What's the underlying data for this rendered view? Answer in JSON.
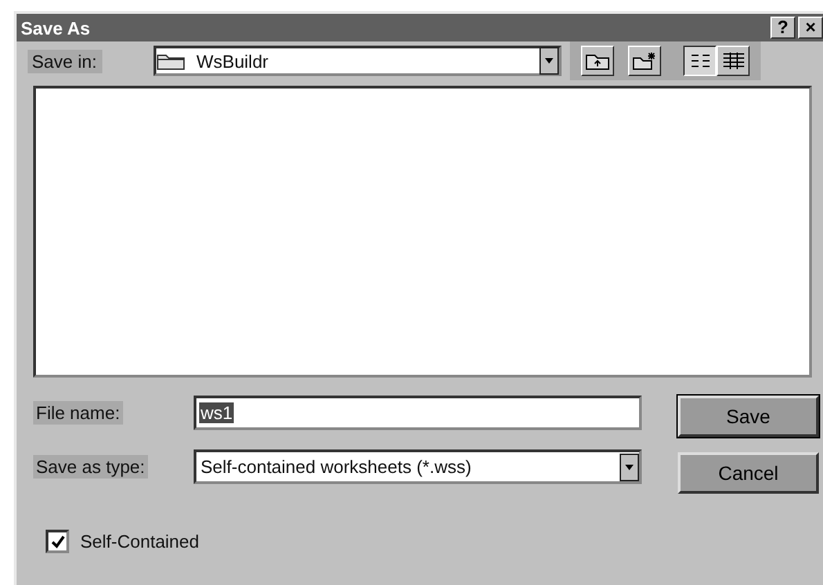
{
  "window": {
    "title": "Save As",
    "title_buttons": [
      "?",
      "×"
    ]
  },
  "save_in": {
    "label": "Save in:",
    "value": "WsBuildr"
  },
  "view_buttons": [
    {
      "kind": "list",
      "selected": true
    },
    {
      "kind": "details",
      "selected": false
    }
  ],
  "file_name": {
    "label": "File name:",
    "value": "ws1",
    "highlighted": true
  },
  "save_as_type": {
    "label": "Save as type:",
    "value": "Self-contained worksheets (*.wss)"
  },
  "buttons": [
    "Save",
    "Cancel"
  ],
  "checkbox": {
    "label": "Self-Contained",
    "checked": true
  }
}
